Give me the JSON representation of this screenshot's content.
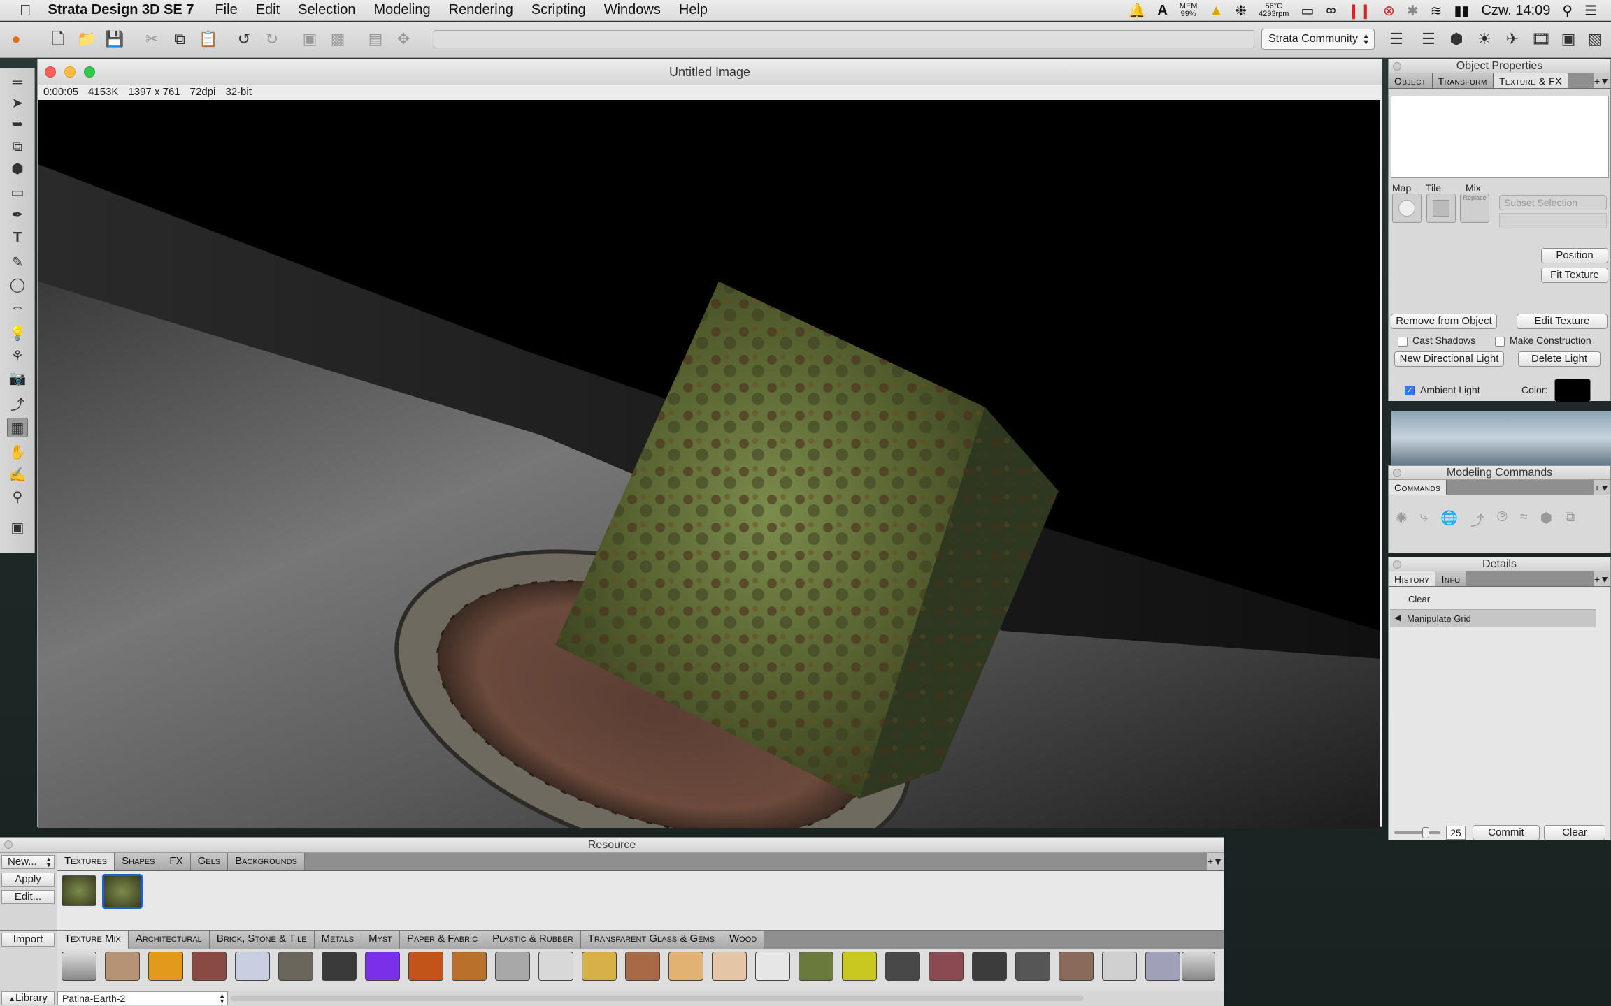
{
  "menubar": {
    "app_name": "Strata Design 3D SE 7",
    "items": [
      "File",
      "Edit",
      "Selection",
      "Modeling",
      "Rendering",
      "Scripting",
      "Windows",
      "Help"
    ]
  },
  "status": {
    "mem_label": "MEM",
    "mem_value": "99%",
    "temp": "56°C",
    "rpm": "4293rpm",
    "clock": "Czw. 14:09"
  },
  "toolbar": {
    "workspace": "Strata Community"
  },
  "document": {
    "title": "Untitled Image",
    "info": [
      "0:00:05",
      "4153K",
      "1397 x 761",
      "72dpi",
      "32-bit"
    ]
  },
  "object_properties": {
    "title": "Object Properties",
    "tabs": [
      "Object",
      "Transform",
      "Texture & FX"
    ],
    "map_label": "Map",
    "tile_label": "Tile",
    "mix_label": "Mix",
    "replace_label": "Replace",
    "subset_placeholder": "Subset Selection",
    "position_button": "Position",
    "fit_texture_button": "Fit Texture",
    "remove_button": "Remove from Object",
    "edit_texture_button": "Edit Texture",
    "cast_shadows": "Cast Shadows",
    "make_construction": "Make Construction",
    "new_light_button": "New Directional Light",
    "delete_light_button": "Delete Light",
    "ambient_label": "Ambient Light",
    "color_label": "Color:"
  },
  "modeling_commands": {
    "title": "Modeling Commands",
    "tab": "Commands"
  },
  "details": {
    "title": "Details",
    "tabs": [
      "History",
      "Info"
    ],
    "clear_label": "Clear",
    "history_items": [
      "Manipulate Grid"
    ],
    "slider_value": "25",
    "commit_button": "Commit",
    "clear_button": "Clear"
  },
  "resource": {
    "title": "Resource",
    "side_buttons": [
      "New...",
      "Apply",
      "Edit...",
      "Import",
      "Library"
    ],
    "tabs": [
      "Textures",
      "Shapes",
      "FX",
      "Gels",
      "Backgrounds"
    ],
    "library_tabs": [
      "Texture Mix",
      "Architectural",
      "Brick, Stone & Tile",
      "Metals",
      "Myst",
      "Paper & Fabric",
      "Plastic & Rubber",
      "Transparent Glass & Gems",
      "Wood"
    ],
    "selected_texture": "Patina-Earth-2"
  },
  "colors": {
    "accent": "#3478f6",
    "ambient_color": "#000000"
  }
}
